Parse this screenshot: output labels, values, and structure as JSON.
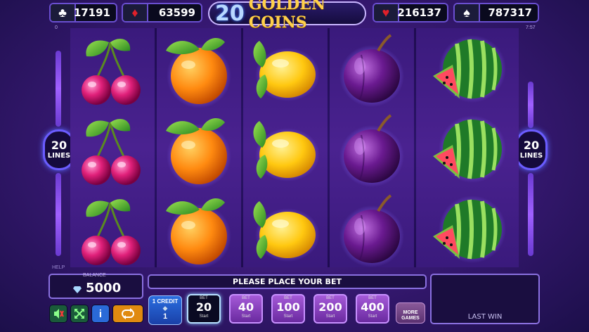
{
  "jackpots": [
    {
      "suit": "♣",
      "suit_icon": "club-icon",
      "value": "17191"
    },
    {
      "suit": "♦",
      "suit_icon": "diamond-icon",
      "value": "63599"
    },
    {
      "suit": "♥",
      "suit_icon": "heart-icon",
      "value": "216137"
    },
    {
      "suit": "♠",
      "suit_icon": "spade-icon",
      "value": "787317"
    }
  ],
  "logo": {
    "number": "20",
    "text": "GOLDEN COINS"
  },
  "corner_left": "0",
  "clock": "7:57",
  "lines_left": {
    "number": "20",
    "label": "LINES"
  },
  "lines_right": {
    "number": "20",
    "label": "LINES"
  },
  "reels": [
    [
      "cherry",
      "cherry",
      "cherry"
    ],
    [
      "orange",
      "orange",
      "orange"
    ],
    [
      "lemon",
      "lemon",
      "lemon"
    ],
    [
      "plum",
      "plum",
      "plum"
    ],
    [
      "watermelon",
      "watermelon",
      "watermelon"
    ]
  ],
  "help_label": "HELP",
  "balance": {
    "label": "BALANCE",
    "value": "5000"
  },
  "message": "PLEASE PLACE YOUR BET",
  "last_win_label": "LAST WIN",
  "credit": {
    "title": "1 CREDIT",
    "value": "1"
  },
  "bets": [
    {
      "label": "BET",
      "value": "20",
      "start": "Start",
      "active": true
    },
    {
      "label": "BET",
      "value": "40",
      "start": "Start",
      "active": false
    },
    {
      "label": "BET",
      "value": "100",
      "start": "Start",
      "active": false
    },
    {
      "label": "BET",
      "value": "200",
      "start": "Start",
      "active": false
    },
    {
      "label": "BET",
      "value": "400",
      "start": "Start",
      "active": false
    }
  ],
  "more_games": "MORE GAMES",
  "buttons": {
    "sound_icon": "sound-icon",
    "fullscreen_icon": "fullscreen-icon",
    "info": "i",
    "autoplay_icon": "autoplay-icon"
  },
  "colors": {
    "accent": "#8a70e0",
    "gold": "#ffd04a",
    "active_bet": "#b8e0ff"
  }
}
